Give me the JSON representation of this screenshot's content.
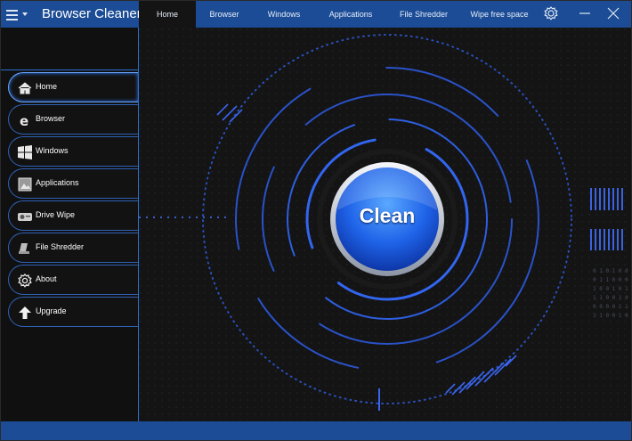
{
  "app": {
    "title": "Browser Cleaner"
  },
  "tabs": [
    {
      "label": "Home"
    },
    {
      "label": "Browser"
    },
    {
      "label": "Windows"
    },
    {
      "label": "Applications"
    },
    {
      "label": "File Shredder"
    },
    {
      "label": "Wipe free space"
    }
  ],
  "sidebar": {
    "items": [
      {
        "label": "Home",
        "icon": "home-icon"
      },
      {
        "label": "Browser",
        "icon": "browser-e-icon"
      },
      {
        "label": "Windows",
        "icon": "windows-logo-icon"
      },
      {
        "label": "Applications",
        "icon": "applications-icon"
      },
      {
        "label": "Drive Wipe",
        "icon": "drive-wipe-icon"
      },
      {
        "label": "File Shredder",
        "icon": "file-shredder-icon"
      },
      {
        "label": "About",
        "icon": "gear-icon"
      },
      {
        "label": "Upgrade",
        "icon": "arrow-up-icon"
      }
    ]
  },
  "main": {
    "clean_label": "Clean"
  },
  "colors": {
    "accent": "#1b4c95",
    "ring": "#2f5fe6",
    "background": "#141414"
  }
}
